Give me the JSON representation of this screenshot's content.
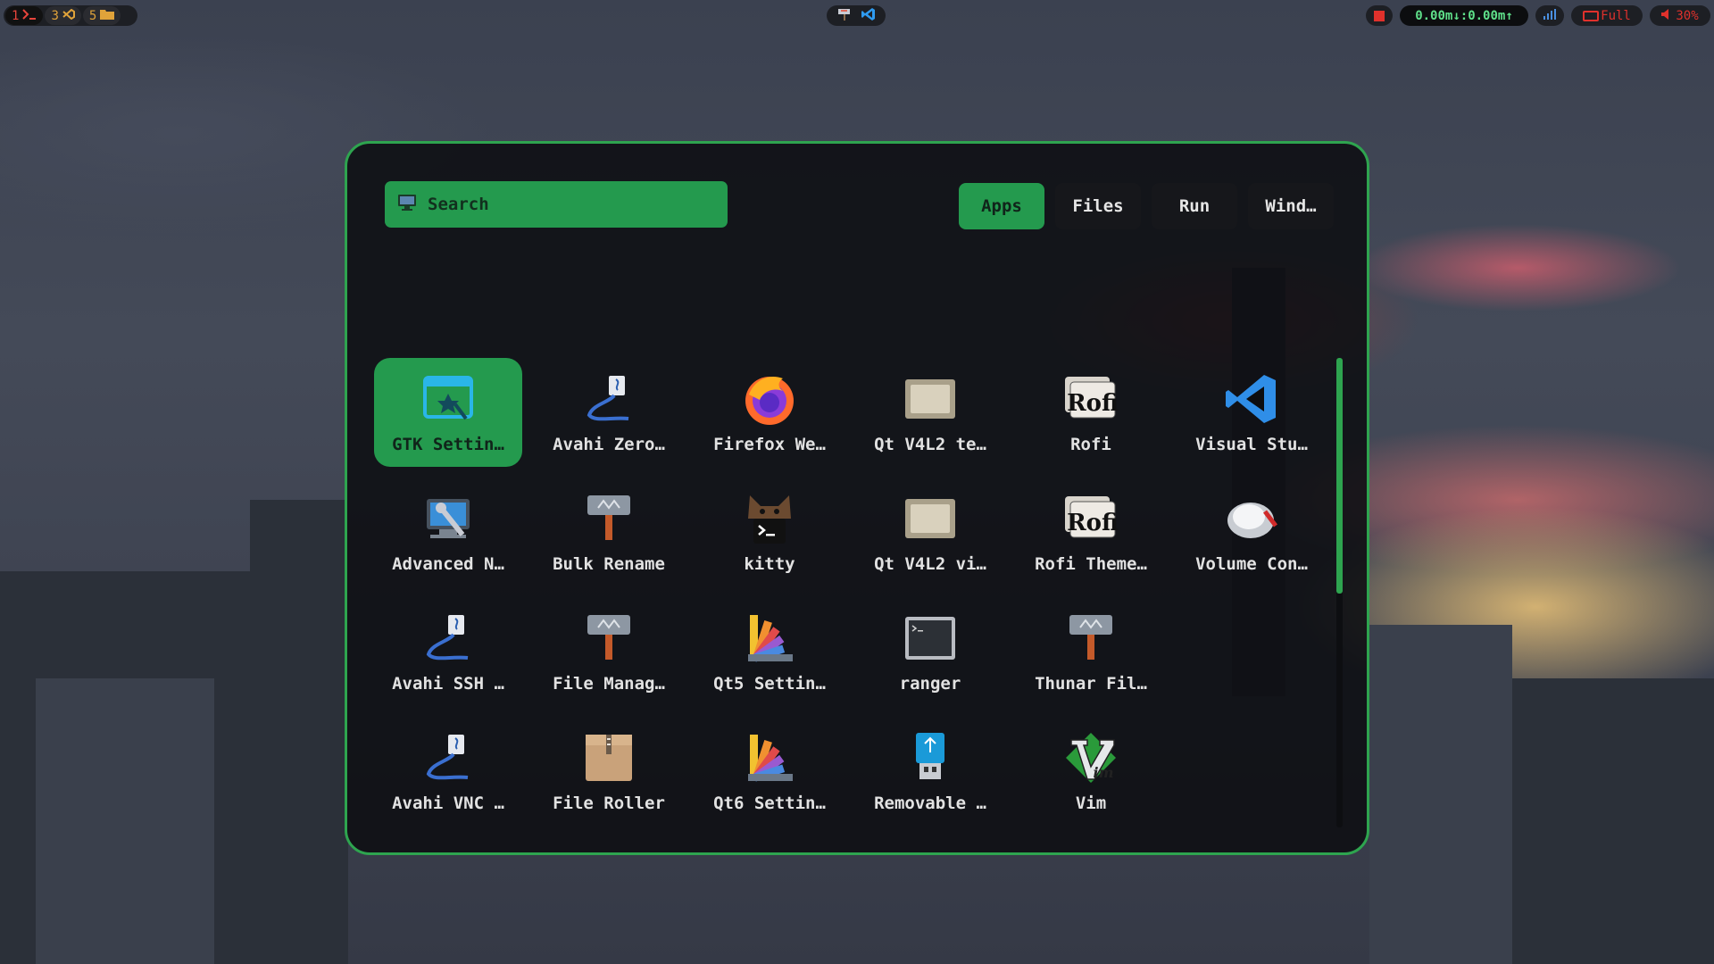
{
  "topbar": {
    "workspaces": [
      {
        "num": "1",
        "icon": "terminal-icon",
        "active": true
      },
      {
        "num": "3",
        "icon": "vscode-icon",
        "active": false
      },
      {
        "num": "5",
        "icon": "folder-icon",
        "active": false
      }
    ],
    "center_icons": [
      "paint-roller-icon",
      "vscode-icon"
    ],
    "network": "0.00m↓:0.00m↑",
    "battery": "Full",
    "volume": "30%"
  },
  "launcher": {
    "search_placeholder": "Search",
    "tabs": [
      "Apps",
      "Files",
      "Run",
      "Wind…"
    ],
    "active_tab": "Apps",
    "apps": [
      "GTK Settin…",
      "Avahi Zero…",
      "Firefox We…",
      "Qt V4L2 te…",
      "Rofi",
      "Visual Stu…",
      "Advanced N…",
      "Bulk Rename",
      "kitty",
      "Qt V4L2 vi…",
      "Rofi Theme…",
      "Volume Con…",
      "Avahi SSH …",
      "File Manag…",
      "Qt5 Settin…",
      "ranger",
      "Thunar Fil…",
      "Avahi VNC …",
      "File Roller",
      "Qt6 Settin…",
      "Removable …",
      "Vim"
    ],
    "selected_app": "GTK Settin…"
  },
  "colors": {
    "accent": "#2ea44f",
    "selection": "#249a4e",
    "launcher_bg": "#0c0d10"
  }
}
